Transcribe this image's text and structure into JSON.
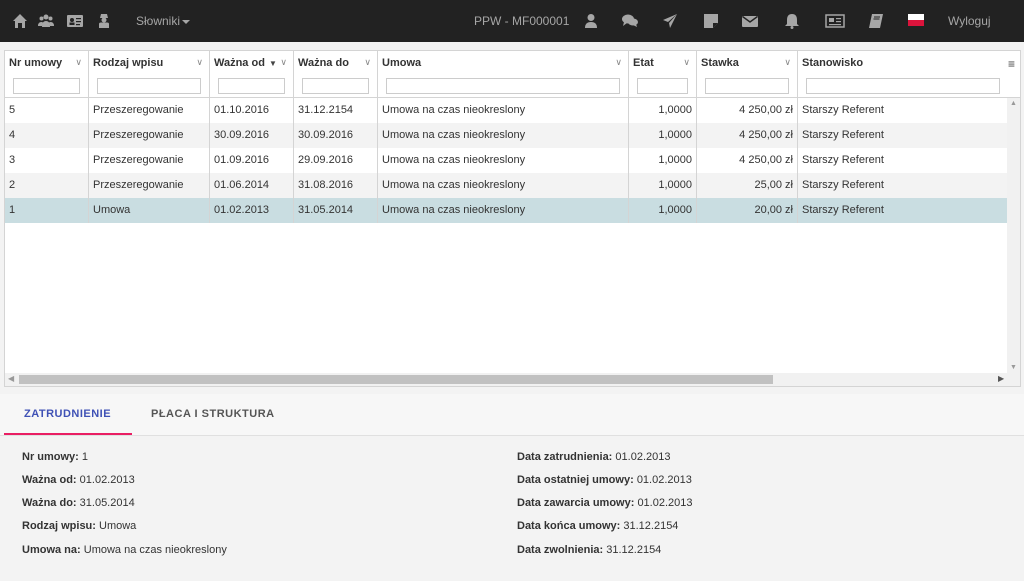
{
  "navbar": {
    "slowniki_label": "Słowniki",
    "ppw_label": "PPW - MF000001",
    "logout_label": "Wyloguj"
  },
  "grid": {
    "columns": [
      "Nr umowy",
      "Rodzaj wpisu",
      "Ważna od",
      "Ważna do",
      "Umowa",
      "Etat",
      "Stawka",
      "Stanowisko"
    ],
    "rows": [
      [
        "5",
        "Przeszeregowanie",
        "01.10.2016",
        "31.12.2154",
        "Umowa na czas nieokreslony",
        "1,0000",
        "4 250,00 zł",
        "Starszy Referent"
      ],
      [
        "4",
        "Przeszeregowanie",
        "30.09.2016",
        "30.09.2016",
        "Umowa na czas nieokreslony",
        "1,0000",
        "4 250,00 zł",
        "Starszy Referent"
      ],
      [
        "3",
        "Przeszeregowanie",
        "01.09.2016",
        "29.09.2016",
        "Umowa na czas nieokreslony",
        "1,0000",
        "4 250,00 zł",
        "Starszy Referent"
      ],
      [
        "2",
        "Przeszeregowanie",
        "01.06.2014",
        "31.08.2016",
        "Umowa na czas nieokreslony",
        "1,0000",
        "25,00 zł",
        "Starszy Referent"
      ],
      [
        "1",
        "Umowa",
        "01.02.2013",
        "31.05.2014",
        "Umowa na czas nieokreslony",
        "1,0000",
        "20,00 zł",
        "Starszy Referent"
      ]
    ],
    "selected_row_index": 4
  },
  "tabs": {
    "zatrudnienie": "ZATRUDNIENIE",
    "placa": "PŁACA I STRUKTURA"
  },
  "details": {
    "left": [
      {
        "label": "Nr umowy:",
        "value": "1"
      },
      {
        "label": "Ważna od:",
        "value": "01.02.2013"
      },
      {
        "label": "Ważna do:",
        "value": "31.05.2014"
      },
      {
        "label": "Rodzaj wpisu:",
        "value": "Umowa"
      },
      {
        "label": "Umowa na:",
        "value": "Umowa na czas nieokreslony"
      }
    ],
    "right": [
      {
        "label": "Data zatrudnienia:",
        "value": "01.02.2013"
      },
      {
        "label": "Data ostatniej umowy:",
        "value": "01.02.2013"
      },
      {
        "label": "Data zawarcia umowy:",
        "value": "01.02.2013"
      },
      {
        "label": "Data końca umowy:",
        "value": "31.12.2154"
      },
      {
        "label": "Data zwolnienia:",
        "value": "31.12.2154"
      }
    ]
  }
}
